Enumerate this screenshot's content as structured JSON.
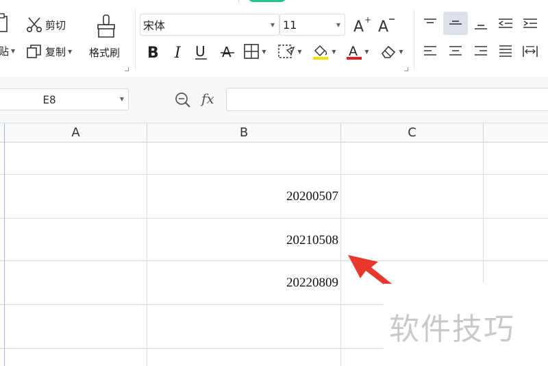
{
  "ribbon": {
    "cut_label": "剪切",
    "paste_label_partial": "贴",
    "copy_label": "复制",
    "format_painter_label": "格式刷",
    "font_name": "宋体",
    "font_size": "11",
    "accent_green": "#27c28a",
    "highlight_color": "#f5e000",
    "font_color": "#e02020"
  },
  "formula_bar": {
    "name_box": "E8",
    "fx_label": "fx",
    "formula_value": ""
  },
  "grid": {
    "columns": [
      "A",
      "B",
      "C"
    ],
    "cells": [
      {
        "ref": "B2",
        "value": "20200507"
      },
      {
        "ref": "B3",
        "value": "20210508"
      },
      {
        "ref": "B4",
        "value": "20220809"
      }
    ]
  },
  "annotation": {
    "arrow_color": "#e8382e"
  },
  "watermark": {
    "text": "软件技巧"
  }
}
